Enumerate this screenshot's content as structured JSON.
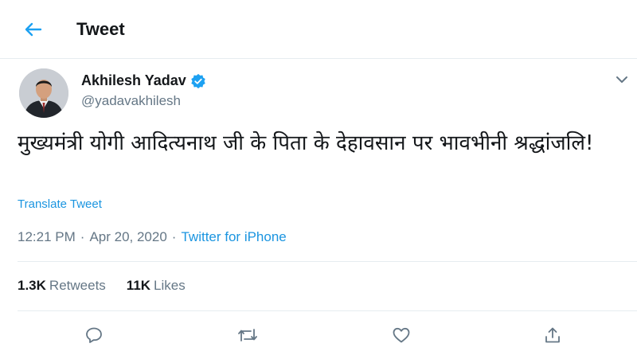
{
  "header": {
    "title": "Tweet",
    "back_icon": "back-arrow-icon"
  },
  "author": {
    "name": "Akhilesh Yadav",
    "handle": "@yadavakhilesh",
    "verified": true
  },
  "tweet": {
    "text": "मुख्यमंत्री योगी आदित्यनाथ जी के पिता के देहावसान पर भावभीनी श्रद्धांजलि!",
    "translate_label": "Translate Tweet",
    "time": "12:21 PM",
    "separator": "·",
    "date": "Apr 20, 2020",
    "source": "Twitter for iPhone"
  },
  "stats": {
    "retweets_count": "1.3K",
    "retweets_label": "Retweets",
    "likes_count": "11K",
    "likes_label": "Likes"
  },
  "actions": [
    "reply-icon",
    "retweet-icon",
    "like-icon",
    "share-icon"
  ],
  "colors": {
    "accent": "#1b95e0",
    "text": "#14171a",
    "secondary": "#657786",
    "divider": "#e6ecf0"
  }
}
